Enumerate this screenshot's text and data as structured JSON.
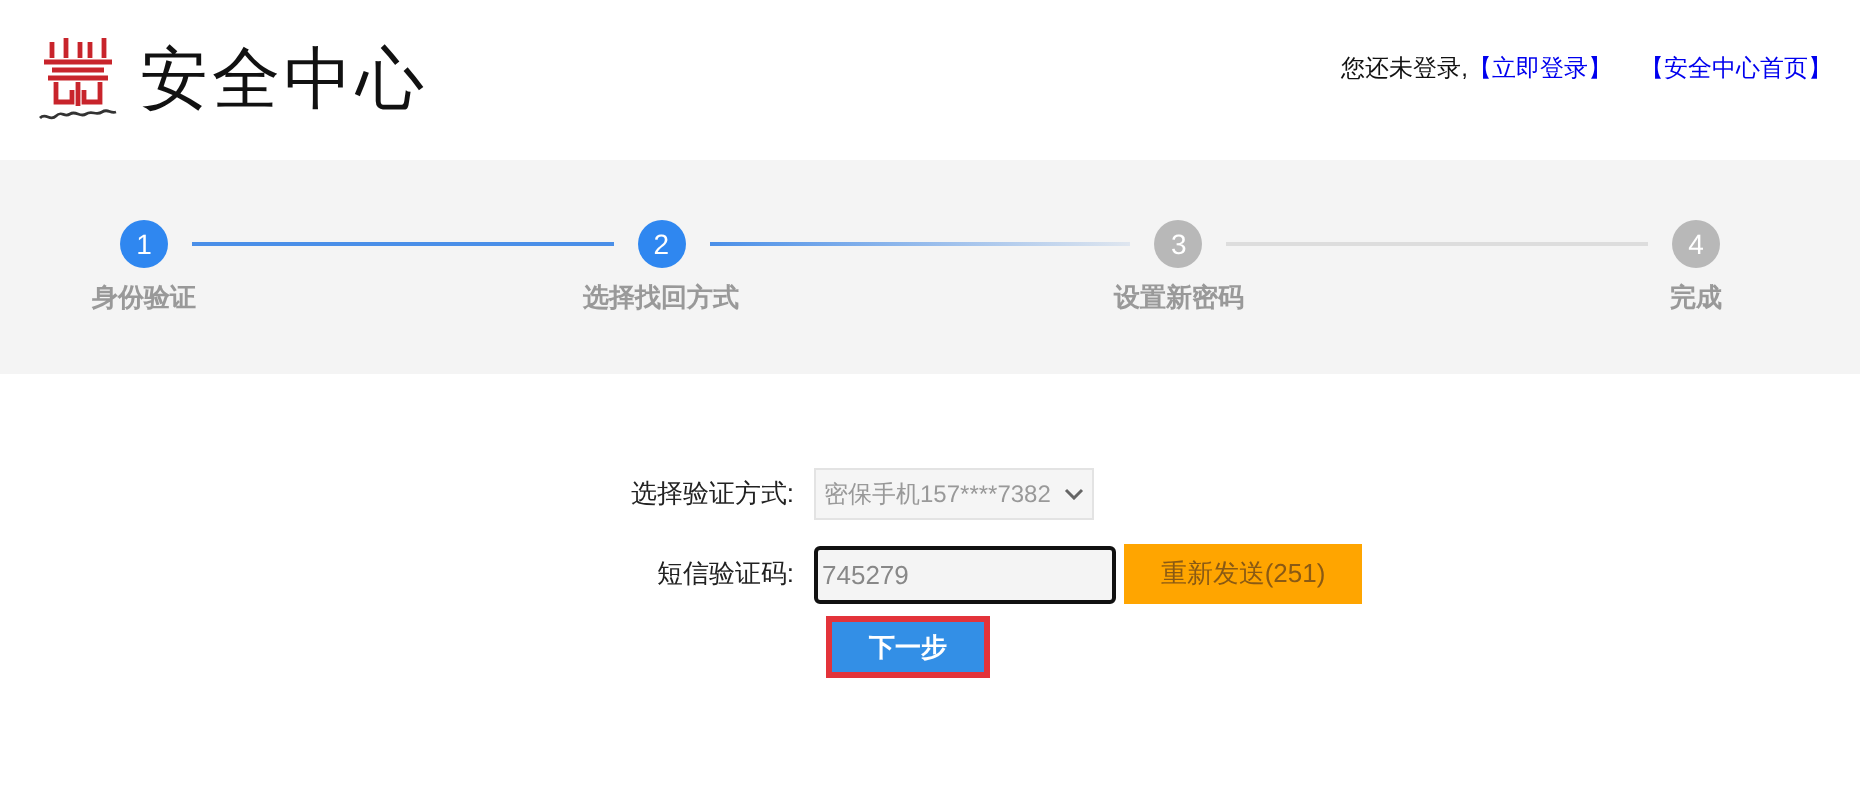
{
  "header": {
    "title": "安全中心",
    "status_text": "您还未登录,",
    "links": [
      "【立即登录】",
      "【安全中心首页】"
    ]
  },
  "steps": [
    {
      "number": "1",
      "label": "身份验证",
      "completed": true
    },
    {
      "number": "2",
      "label": "选择找回方式",
      "completed": true
    },
    {
      "number": "3",
      "label": "设置新密码",
      "completed": false
    },
    {
      "number": "4",
      "label": "完成",
      "completed": false
    }
  ],
  "form": {
    "method_label": "选择验证方式:",
    "method_value": "密保手机157****7382",
    "code_label": "短信验证码:",
    "code_value": "745279",
    "resend_button": {
      "label": "重新发送(251)",
      "disabled": true
    },
    "next_button": "下一步"
  }
}
